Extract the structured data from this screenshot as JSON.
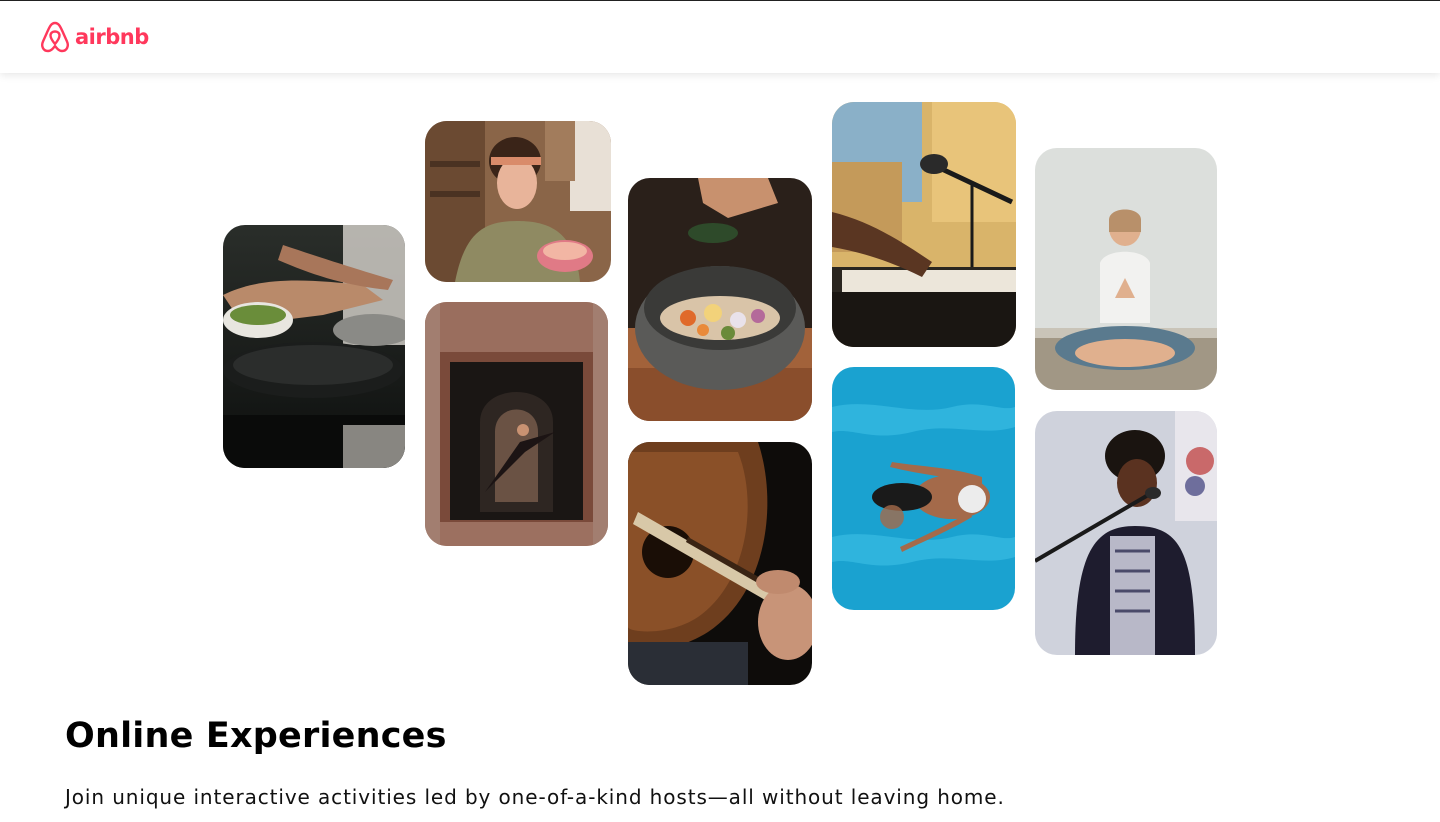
{
  "header": {
    "logo_text": "airbnb",
    "logo_icon": "airbnb-belo-icon",
    "brand_color": "#FF385C"
  },
  "gallery": {
    "photos": [
      {
        "name": "cooking-class-photo"
      },
      {
        "name": "macarons-baker-photo"
      },
      {
        "name": "dancer-archway-photo"
      },
      {
        "name": "seasoning-bowl-photo"
      },
      {
        "name": "acoustic-guitar-photo"
      },
      {
        "name": "keyboard-microphone-photo"
      },
      {
        "name": "swimmer-pool-photo"
      },
      {
        "name": "yoga-meditation-photo"
      },
      {
        "name": "singer-microphone-photo"
      }
    ]
  },
  "main": {
    "title": "Online Experiences",
    "subtitle": "Join unique interactive activities led by one-of-a-kind hosts—all without leaving home."
  }
}
